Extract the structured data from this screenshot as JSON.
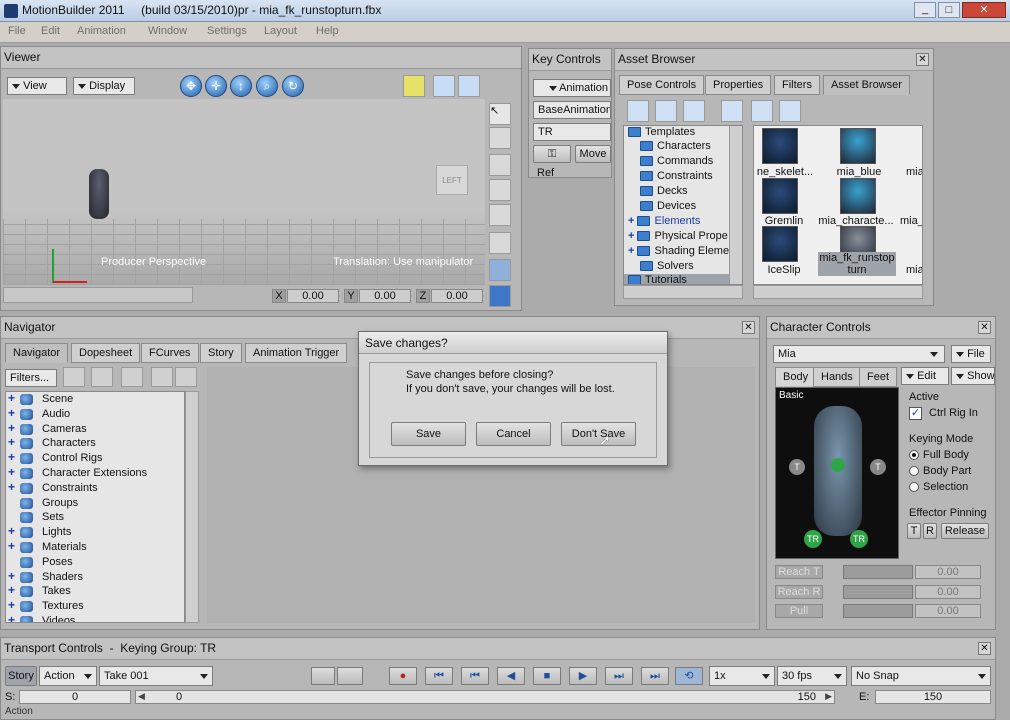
{
  "window": {
    "title": "MotionBuilder 2011     (build 03/15/2010)pr - mia_fk_runstopturn.fbx",
    "controls": [
      "_",
      "□",
      "✕"
    ]
  },
  "menu": [
    "File",
    "Edit",
    "Animation",
    "Window",
    "Settings",
    "Layout",
    "Help"
  ],
  "viewer": {
    "title": "Viewer",
    "view_label": "View",
    "display_label": "Display",
    "camera_label": "Producer Perspective",
    "status": "Translation: Use manipulator",
    "left_cube": "LEFT",
    "coords": [
      "0.00",
      "0.00",
      "0.00"
    ],
    "coord_axes": [
      "X",
      "Y",
      "Z"
    ]
  },
  "key_controls": {
    "title": "Key Controls",
    "animation": "Animation",
    "base_animation": "BaseAnimation",
    "tr": "TR",
    "move": "Move",
    "ref": "Ref"
  },
  "asset_browser": {
    "title": "Asset Browser",
    "tabs": [
      "Pose Controls",
      "Properties",
      "Filters",
      "Asset Browser"
    ],
    "tree": [
      "Templates",
      "Characters",
      "Commands",
      "Constraints",
      "Decks",
      "Devices",
      "Elements",
      "Physical Prope",
      "Shading Eleme",
      "Solvers",
      "Tutorials"
    ],
    "assets": [
      [
        "ne_skelet...",
        "mia_blue",
        "mia"
      ],
      [
        "Gremlin",
        "mia_characte...",
        "mia_r"
      ],
      [
        "IceSlip",
        "mia_fk_runstop turn",
        "mia"
      ]
    ]
  },
  "navigator": {
    "title": "Navigator",
    "tabs": [
      "Navigator",
      "Dopesheet",
      "FCurves",
      "Story",
      "Animation Trigger"
    ],
    "filters_label": "Filters...",
    "items": [
      "Scene",
      "Audio",
      "Cameras",
      "Characters",
      "Control Rigs",
      "Character Extensions",
      "Constraints",
      "Groups",
      "Sets",
      "Lights",
      "Materials",
      "Poses",
      "Shaders",
      "Takes",
      "Textures",
      "Videos"
    ]
  },
  "dialog": {
    "title": "Save changes?",
    "line1": "Save changes before closing?",
    "line2": "If you don't save, your changes will be lost.",
    "save": "Save",
    "cancel": "Cancel",
    "dont_save": "Don't Save"
  },
  "character_controls": {
    "title": "Character Controls",
    "character": "Mia",
    "file": "File",
    "tabs": [
      "Body",
      "Hands",
      "Feet"
    ],
    "edit": "Edit",
    "show": "Show",
    "basic": "Basic",
    "active_label": "Active",
    "ctrl_rig": "Ctrl Rig In",
    "keying_mode": "Keying Mode",
    "modes": [
      "Full Body",
      "Body Part",
      "Selection"
    ],
    "effector_pinning": "Effector Pinning",
    "pin_t": "T",
    "pin_r": "R",
    "release": "Release",
    "reach": [
      "Reach T",
      "Reach R",
      "Pull"
    ],
    "reach_values": [
      "0.00",
      "0.00",
      "0.00"
    ],
    "tr_marker": "TR",
    "t_marker": "T"
  },
  "transport": {
    "title": "Transport Controls  -  Keying Group: TR",
    "story": "Story",
    "action": "Action",
    "take": "Take 001",
    "speed": "1x",
    "fps": "30 fps",
    "snap": "No Snap",
    "start_label": "S:",
    "start": "0",
    "cursor": "0",
    "end_marker": "150",
    "end_label": "E:",
    "end": "150",
    "action_row": "Action"
  }
}
